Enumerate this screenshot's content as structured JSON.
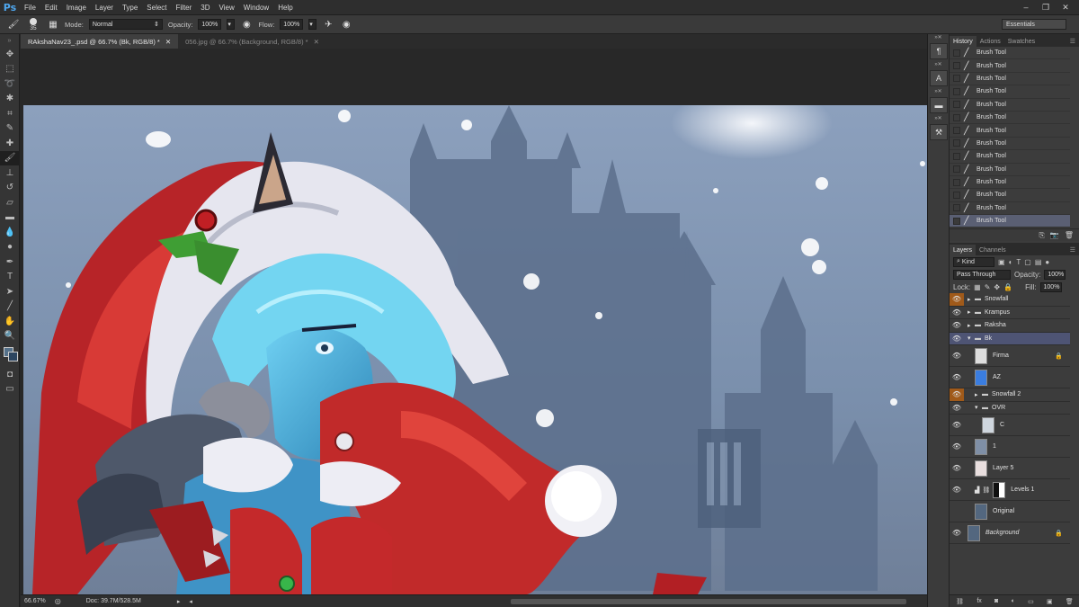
{
  "app": {
    "logo": "Ps"
  },
  "menu": [
    "File",
    "Edit",
    "Image",
    "Layer",
    "Type",
    "Select",
    "Filter",
    "3D",
    "View",
    "Window",
    "Help"
  ],
  "window_controls": [
    "–",
    "❐",
    "✕"
  ],
  "options": {
    "brush_size": "35",
    "mode_label": "Mode:",
    "mode_value": "Normal",
    "opacity_label": "Opacity:",
    "opacity_value": "100%",
    "flow_label": "Flow:",
    "flow_value": "100%",
    "workspace": "Essentials"
  },
  "doc_tabs": [
    {
      "label": "RAkshaNav23_.psd @ 66.7% (Bk, RGB/8) *",
      "active": true
    },
    {
      "label": "056.jpg @ 66.7% (Background, RGB/8) *",
      "active": false
    }
  ],
  "status": {
    "zoom": "66.67%",
    "doc": "Doc: 39.7M/528.5M"
  },
  "history": {
    "tabs": [
      "History",
      "Actions",
      "Swatches"
    ],
    "items": [
      "Brush Tool",
      "Brush Tool",
      "Brush Tool",
      "Brush Tool",
      "Brush Tool",
      "Brush Tool",
      "Brush Tool",
      "Brush Tool",
      "Brush Tool",
      "Brush Tool",
      "Brush Tool",
      "Brush Tool",
      "Brush Tool",
      "Brush Tool"
    ],
    "selected_index": 13
  },
  "layers": {
    "tabs": [
      "Layers",
      "Channels"
    ],
    "filter_kind": "Kind",
    "blend_mode": "Pass Through",
    "opacity_label": "Opacity:",
    "opacity_value": "100%",
    "lock_label": "Lock:",
    "fill_label": "Fill:",
    "fill_value": "100%",
    "items": [
      {
        "name": "Snowfall",
        "type": "group",
        "indent": 0,
        "eye": "orange",
        "selected": false
      },
      {
        "name": "Krampus",
        "type": "group",
        "indent": 0,
        "eye": "normal",
        "selected": false
      },
      {
        "name": "Raksha",
        "type": "group",
        "indent": 0,
        "eye": "normal",
        "selected": false
      },
      {
        "name": "Bk",
        "type": "group-open",
        "indent": 0,
        "eye": "normal",
        "selected": true
      },
      {
        "name": "Firma",
        "type": "layer",
        "indent": 1,
        "eye": "normal",
        "selected": false,
        "locked": true,
        "thumb": "#ddd"
      },
      {
        "name": "AZ",
        "type": "layer",
        "indent": 1,
        "eye": "normal",
        "selected": false,
        "thumb": "#3a7de0"
      },
      {
        "name": "Snowfall 2",
        "type": "group",
        "indent": 1,
        "eye": "orange",
        "selected": false
      },
      {
        "name": "OVR",
        "type": "group-open",
        "indent": 1,
        "eye": "normal",
        "selected": false
      },
      {
        "name": "C",
        "type": "layer",
        "indent": 2,
        "eye": "normal",
        "selected": false,
        "thumb": "#cfd6de"
      },
      {
        "name": "1",
        "type": "layer",
        "indent": 1,
        "eye": "normal",
        "selected": false,
        "thumb": "#7f8fa6"
      },
      {
        "name": "Layer 5",
        "type": "layer",
        "indent": 1,
        "eye": "normal",
        "selected": false,
        "thumb": "#e8dede"
      },
      {
        "name": "Levels 1",
        "type": "adjust",
        "indent": 1,
        "eye": "normal",
        "selected": false,
        "thumb": "#111"
      },
      {
        "name": "Original",
        "type": "layer",
        "indent": 1,
        "eye": "none",
        "selected": false,
        "thumb": "#53677f"
      },
      {
        "name": "Background",
        "type": "layer",
        "indent": 0,
        "eye": "normal",
        "selected": false,
        "locked": true,
        "italic": true,
        "thumb": "#53677f"
      }
    ],
    "footer_icons": [
      "⛓",
      "fx",
      "◙",
      "◐",
      "▭",
      "▣",
      "🗑"
    ]
  },
  "colors": {
    "accent": "#4fa8f0",
    "selection": "#4e5474",
    "orange_eye": "#a05a1a"
  }
}
